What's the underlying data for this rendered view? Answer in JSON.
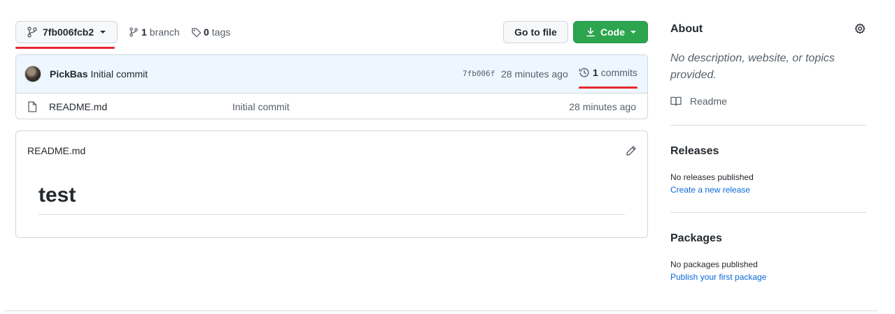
{
  "repo_bar": {
    "branch_name": "7fb006fcb2",
    "branches_count": "1",
    "branches_label": "branch",
    "tags_count": "0",
    "tags_label": "tags",
    "goto_file_label": "Go to file",
    "code_label": "Code"
  },
  "latest_commit": {
    "author": "PickBas",
    "message": "Initial commit",
    "sha": "7fb006f",
    "time": "28 minutes ago",
    "commits_count": "1",
    "commits_label": "commits"
  },
  "files": [
    {
      "name": "README.md",
      "message": "Initial commit",
      "time": "28 minutes ago",
      "icon": "file-icon"
    }
  ],
  "readme": {
    "filename": "README.md",
    "heading": "test"
  },
  "sidebar": {
    "about_title": "About",
    "about_description": "No description, website, or topics provided.",
    "readme_label": "Readme",
    "releases_title": "Releases",
    "releases_empty": "No releases published",
    "releases_link": "Create a new release",
    "packages_title": "Packages",
    "packages_empty": "No packages published",
    "packages_link": "Publish your first package"
  },
  "colors": {
    "accent_green": "#2da44e",
    "link_blue": "#0969da",
    "annotation_red": "#e5292f",
    "commit_row_bg": "#eef6ff"
  }
}
